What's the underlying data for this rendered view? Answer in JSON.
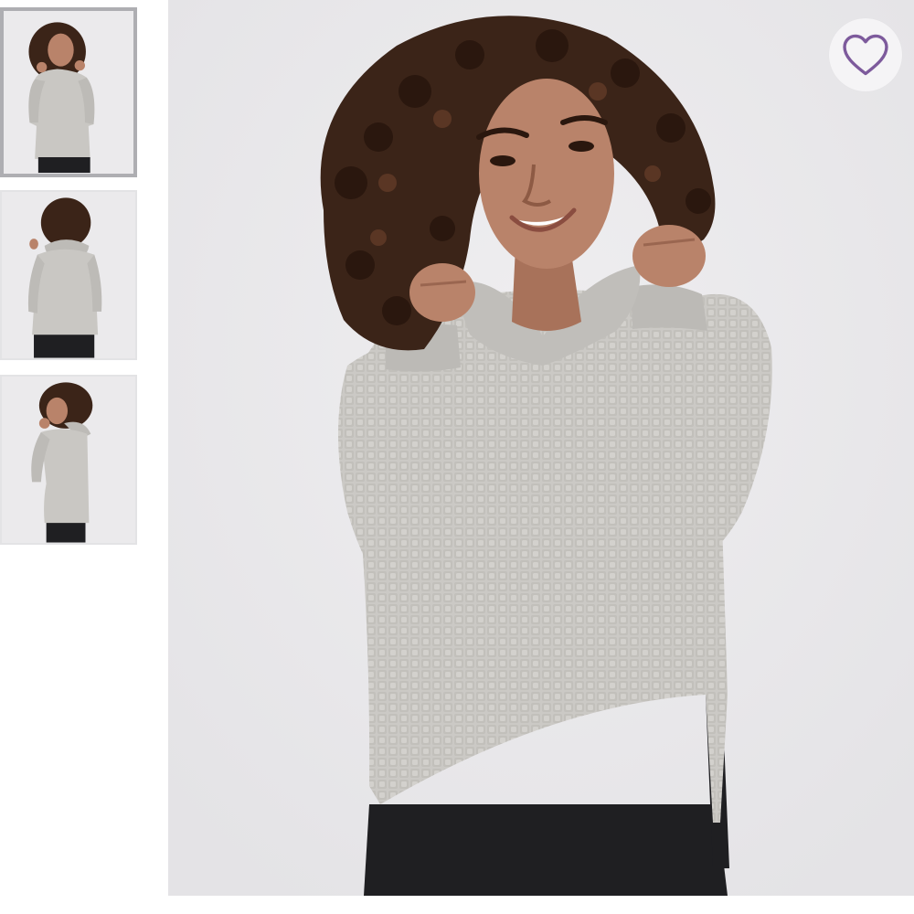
{
  "gallery": {
    "thumbnails": [
      {
        "view": "front",
        "selected": true
      },
      {
        "view": "back",
        "selected": false
      },
      {
        "view": "side",
        "selected": false
      }
    ],
    "main_image": {
      "view": "front"
    },
    "like_button": {
      "icon": "heart-outline-icon",
      "color": "#7d5a9c"
    }
  },
  "colors": {
    "background": "#ffffff",
    "photo_backdrop": "#e9e8ea",
    "sweater": "#c9c7c3",
    "leggings": "#1f1f22",
    "hair": "#3b2418",
    "skin": "#b9836a",
    "heart": "#7d5a9c"
  }
}
